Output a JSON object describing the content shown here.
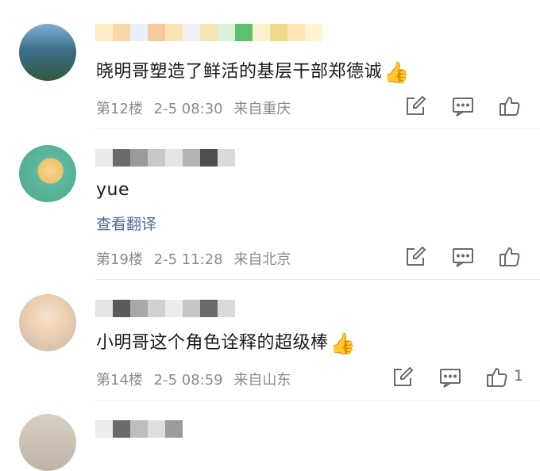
{
  "comments": [
    {
      "text": "晓明哥塑造了鲜活的基层干部郑德诚",
      "floor": "第12楼",
      "date": "2-5 08:30",
      "location": "来自重庆",
      "likes": "",
      "has_translate": false,
      "thumb_emoji": "👍",
      "avatar_colors": [
        "#3d6f8c",
        "#6b9bbf",
        "#3e6f47"
      ]
    },
    {
      "text": "yue",
      "floor": "第19楼",
      "date": "2-5 11:28",
      "location": "来自北京",
      "likes": "",
      "has_translate": true,
      "translate_label": "查看翻译",
      "thumb_emoji": "",
      "avatar_colors": [
        "#5cb89e",
        "#f2c88a",
        "#ffffff"
      ]
    },
    {
      "text": "小明哥这个角色诠释的超级棒",
      "floor": "第14楼",
      "date": "2-5 08:59",
      "location": "来自山东",
      "likes": "1",
      "has_translate": false,
      "thumb_emoji": "👍",
      "avatar_colors": [
        "#f3dcc8",
        "#e8b890",
        "#cfc0b0"
      ]
    }
  ],
  "icons": {
    "reply": "edit-icon",
    "comment": "comment-icon",
    "like": "thumbs-up-icon"
  },
  "colors": {
    "text": "#1a1a1a",
    "meta": "#8a8a8a",
    "link": "#4a6e97",
    "icon": "#6a6a6a"
  }
}
